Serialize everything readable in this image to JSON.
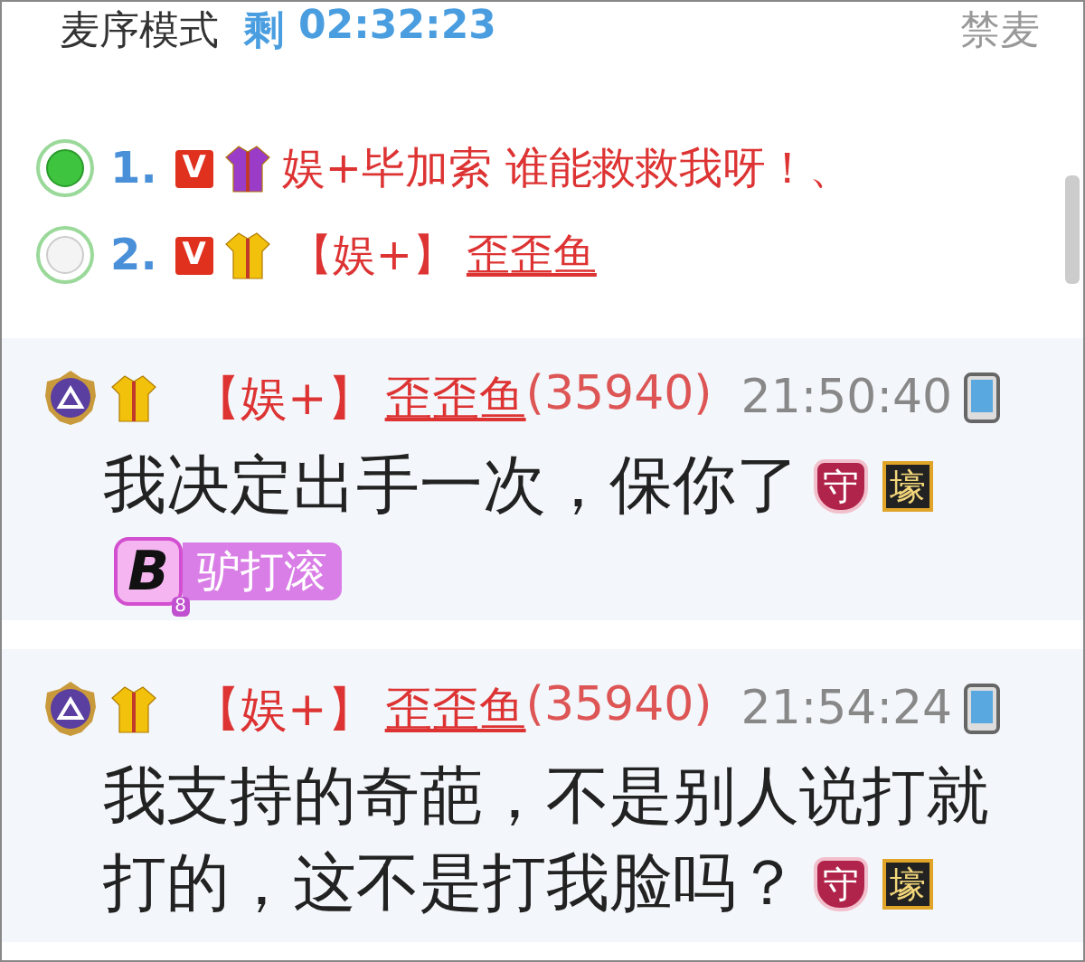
{
  "header": {
    "mode": "麦序模式",
    "remaining_label": "剩",
    "timer": "02:32:23",
    "mute_button": "禁麦"
  },
  "queue": [
    {
      "rank": "1.",
      "speaking": true,
      "vip": "V",
      "color": "#9a3cc8",
      "name": "娱+毕加索 谁能救救我呀！、",
      "linked": false
    },
    {
      "rank": "2.",
      "speaking": false,
      "vip": "V",
      "color": "#f2c10c",
      "tag": "【娱+】",
      "name": "歪歪鱼",
      "linked": true
    }
  ],
  "messages": [
    {
      "tag": "【娱+】",
      "name": "歪歪鱼",
      "id": "(35940)",
      "time": "21:50:40",
      "lines": [
        "我决定出手一次，保你了"
      ],
      "badges": [
        {
          "kind": "guard",
          "label": "守"
        },
        {
          "kind": "rich",
          "label": "壕"
        }
      ],
      "medal": {
        "letter": "B",
        "grade": "8",
        "label": "驴打滚"
      }
    },
    {
      "tag": "【娱+】",
      "name": "歪歪鱼",
      "id": "(35940)",
      "time": "21:54:24",
      "lines": [
        "我支持的奇葩，不是别人说打就",
        "打的，这不是打我脸吗？"
      ],
      "badges": [
        {
          "kind": "guard",
          "label": "守"
        },
        {
          "kind": "rich",
          "label": "壕"
        }
      ]
    }
  ]
}
